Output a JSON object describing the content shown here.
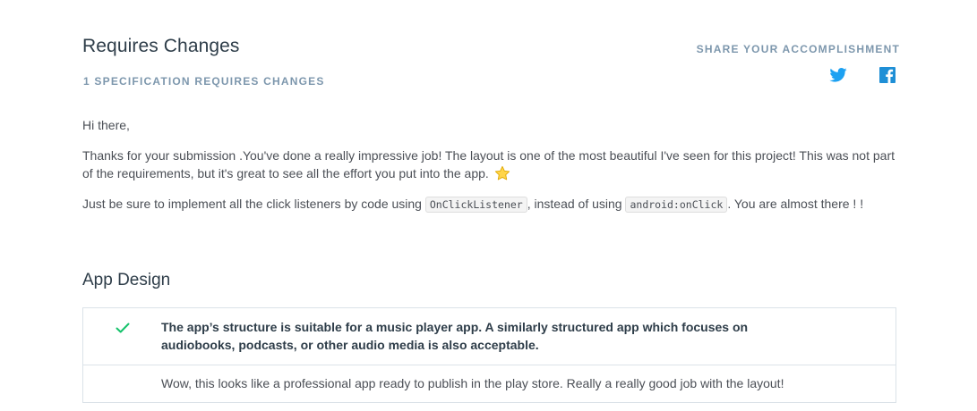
{
  "header": {
    "title": "Requires Changes",
    "subtitle": "1 SPECIFICATION REQUIRES CHANGES"
  },
  "share": {
    "label": "SHARE YOUR ACCOMPLISHMENT",
    "icons": [
      "twitter-icon",
      "facebook-icon"
    ],
    "twitter_color": "#1da1f2",
    "facebook_color": "#3b5998"
  },
  "message": {
    "greeting": "Hi there,",
    "paragraph1": "Thanks for your submission .You've done a really impressive job! The layout is one of the most beautiful I've seen for this project! This was not part of the requirements, but it's great to see all the effort you put into the app.",
    "paragraph1_emoji": "star-icon",
    "paragraph2_part1": "Just be sure to implement all the click listeners by code using",
    "paragraph2_code1": "OnClickListener",
    "paragraph2_part2": ", instead of using",
    "paragraph2_code2": "android:onClick",
    "paragraph2_part3": ". You are almost there ! !"
  },
  "section": {
    "title": "App Design",
    "criteria": [
      {
        "status": "check-icon",
        "status_color": "#02b3e4",
        "text": "The app’s structure is suitable for a music player app. A similarly structured app which focuses on audiobooks, podcasts, or other audio media is also acceptable.",
        "review": "Wow, this looks like a professional app ready to publish in the play store. Really a really good job with the layout!"
      }
    ]
  }
}
